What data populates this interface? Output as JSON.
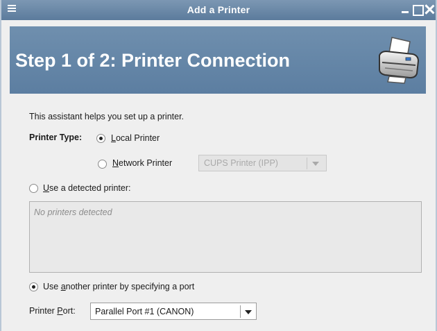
{
  "window": {
    "title": "Add a Printer"
  },
  "header": {
    "heading": "Step 1 of 2: Printer Connection",
    "icon": "printer-icon"
  },
  "content": {
    "intro": "This assistant helps you set up a printer.",
    "printer_type_label": "Printer Type:",
    "local_printer": {
      "mnemonic": "L",
      "rest": "ocal Printer",
      "selected": true
    },
    "network_printer": {
      "mnemonic": "N",
      "rest": "etwork Printer",
      "selected": false
    },
    "network_protocol": {
      "value": "CUPS Printer (IPP)",
      "enabled": false
    },
    "use_detected": {
      "mnemonic": "U",
      "rest": "se a detected printer:",
      "selected": false
    },
    "detected_list": {
      "empty_text": "No printers detected"
    },
    "use_another": {
      "prefix": "Use ",
      "mnemonic": "a",
      "rest": "nother printer by specifying a port",
      "selected": true
    },
    "printer_port": {
      "label_prefix": "Printer ",
      "label_mnemonic": "P",
      "label_rest": "ort:",
      "value": "Parallel Port #1 (CANON)"
    }
  }
}
